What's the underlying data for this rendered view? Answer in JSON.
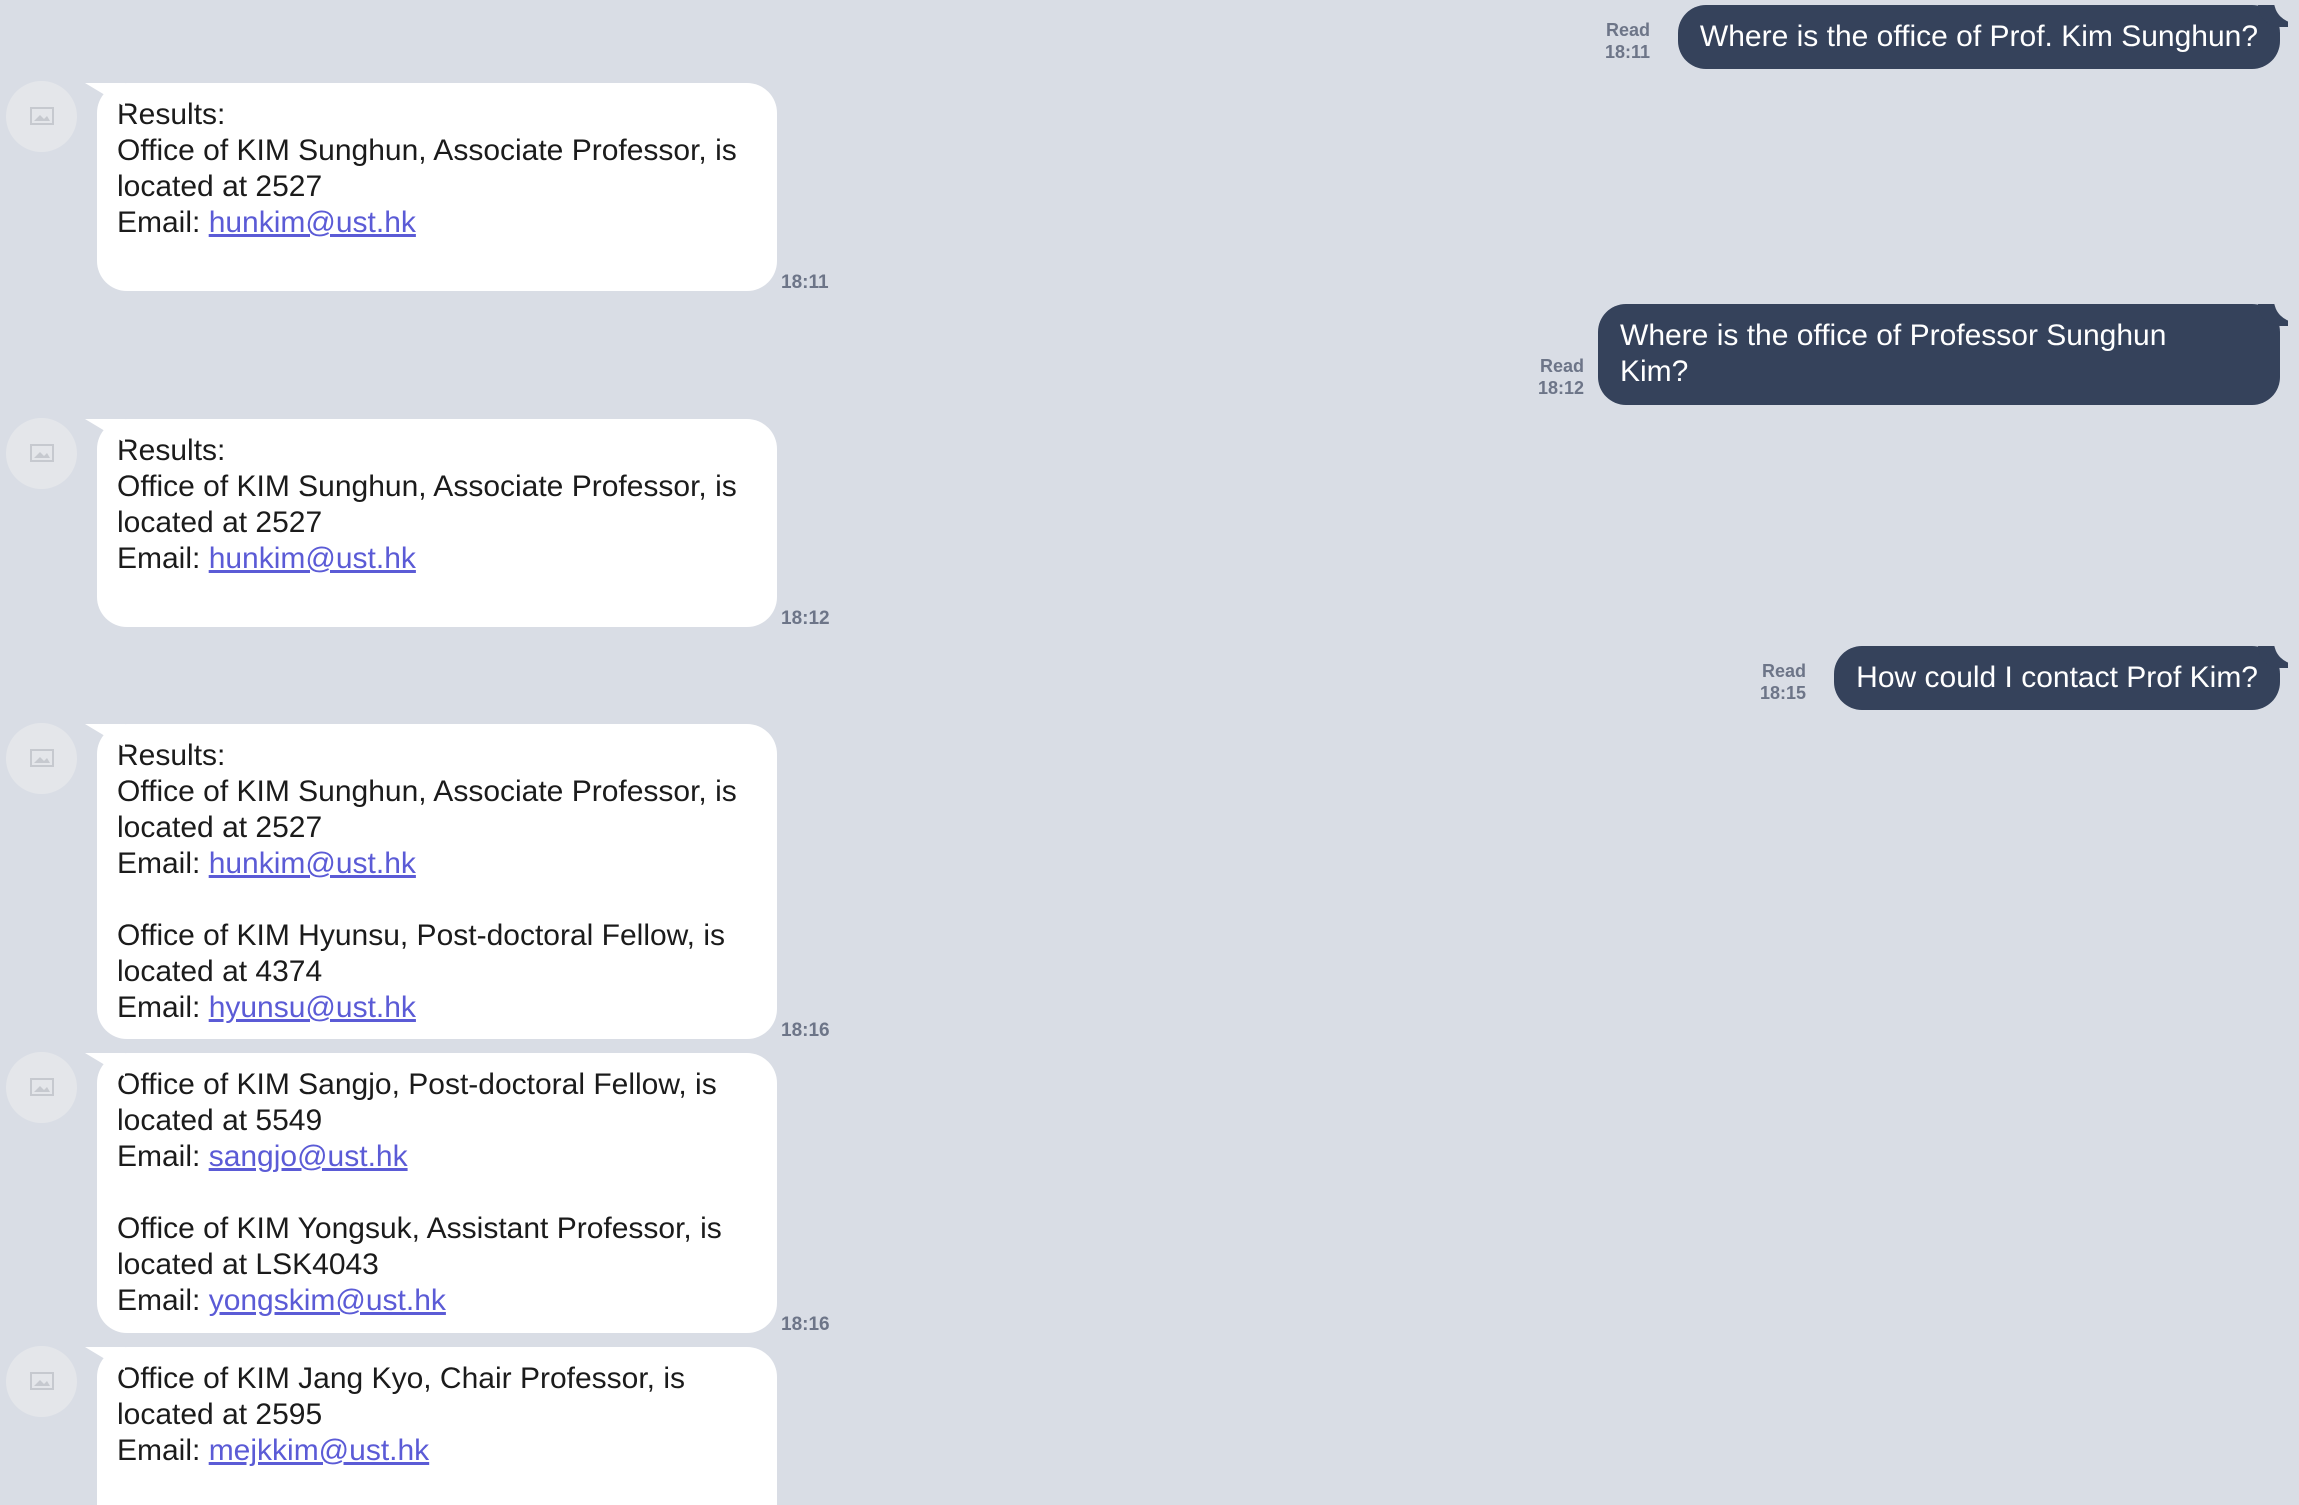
{
  "outgoing": [
    {
      "text_lines": [
        "Where is the office of Prof. Kim Sunghun?"
      ],
      "status": "Read",
      "time": "18:11"
    },
    {
      "text_lines": [
        "Where is the office of Professor Sunghun",
        "Kim?"
      ],
      "status": "Read",
      "time": "18:12"
    },
    {
      "text_lines": [
        "How could I contact Prof Kim?"
      ],
      "status": "Read",
      "time": "18:15"
    }
  ],
  "incoming": [
    {
      "time": "18:11",
      "results_label": "Results:",
      "entries": [
        {
          "line1": "Office of KIM Sunghun, Associate Professor, is",
          "line2": "located at 2527",
          "email_label": "Email: ",
          "email": "hunkim@ust.hk"
        }
      ]
    },
    {
      "time": "18:12",
      "results_label": "Results:",
      "entries": [
        {
          "line1": "Office of KIM Sunghun, Associate Professor, is",
          "line2": "located at 2527",
          "email_label": "Email: ",
          "email": "hunkim@ust.hk"
        }
      ]
    },
    {
      "time": "18:16",
      "results_label": "Results:",
      "entries": [
        {
          "line1": "Office of KIM Sunghun, Associate Professor, is",
          "line2": "located at 2527",
          "email_label": "Email: ",
          "email": "hunkim@ust.hk"
        },
        {
          "line1": "Office of KIM Hyunsu, Post-doctoral Fellow, is",
          "line2": "located at 4374",
          "email_label": "Email: ",
          "email": "hyunsu@ust.hk"
        }
      ]
    },
    {
      "time": "18:16",
      "entries": [
        {
          "line1": "Office of KIM Sangjo, Post-doctoral Fellow, is",
          "line2": "located at 5549",
          "email_label": "Email: ",
          "email": "sangjo@ust.hk"
        },
        {
          "line1": "Office of KIM Yongsuk, Assistant Professor, is",
          "line2": "located at LSK4043",
          "email_label": "Email: ",
          "email": "yongskim@ust.hk"
        }
      ]
    },
    {
      "entries": [
        {
          "line1": "Office of KIM Jang Kyo, Chair Professor, is",
          "line2": "located at 2595",
          "email_label": "Email: ",
          "email": "mejkkim@ust.hk"
        }
      ]
    }
  ],
  "colors": {
    "background": "#d9dde5",
    "outgoing_bubble": "#35425b",
    "incoming_bubble": "#ffffff",
    "link": "#5b5bd6",
    "meta": "#6d7588"
  },
  "icons": {
    "avatar": "image-placeholder-icon"
  }
}
